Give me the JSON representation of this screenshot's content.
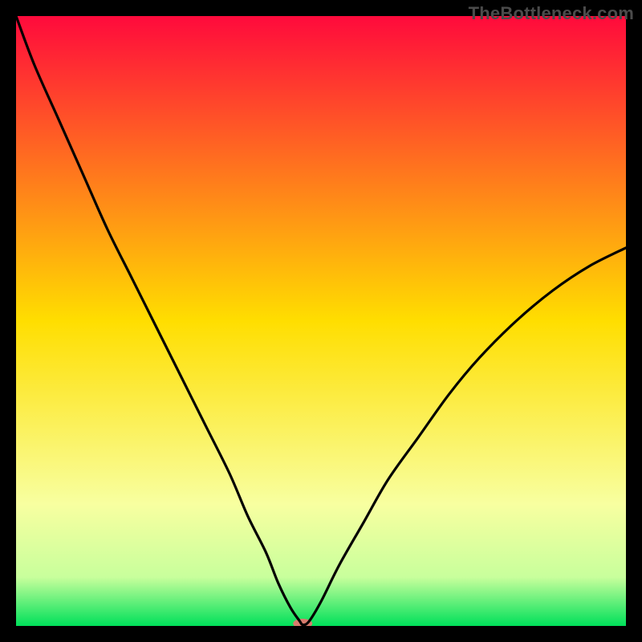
{
  "watermark": "TheBottleneck.com",
  "chart_data": {
    "type": "line",
    "title": "",
    "xlabel": "",
    "ylabel": "",
    "xlim": [
      0,
      100
    ],
    "ylim": [
      0,
      100
    ],
    "grid": false,
    "legend": false,
    "background_gradient": [
      {
        "y": 0,
        "color": "#ff0a3c"
      },
      {
        "y": 50,
        "color": "#ffde00"
      },
      {
        "y": 80,
        "color": "#f8ffa0"
      },
      {
        "y": 92,
        "color": "#c8ff9c"
      },
      {
        "y": 100,
        "color": "#00e05a"
      }
    ],
    "marker": {
      "x": 47,
      "y": 0,
      "color": "#d77b6d",
      "rx": 12,
      "ry": 6
    },
    "series": [
      {
        "name": "bottleneck-curve",
        "x": [
          0,
          3,
          7,
          11,
          15,
          19,
          23,
          27,
          31,
          35,
          38,
          41,
          43,
          45,
          46.5,
          47,
          48,
          50,
          53,
          57,
          61,
          66,
          71,
          76,
          82,
          88,
          94,
          100
        ],
        "values": [
          100,
          92,
          83,
          74,
          65,
          57,
          49,
          41,
          33,
          25,
          18,
          12,
          7,
          3,
          0.8,
          0.2,
          0.7,
          4,
          10,
          17,
          24,
          31,
          38,
          44,
          50,
          55,
          59,
          62
        ]
      }
    ]
  }
}
